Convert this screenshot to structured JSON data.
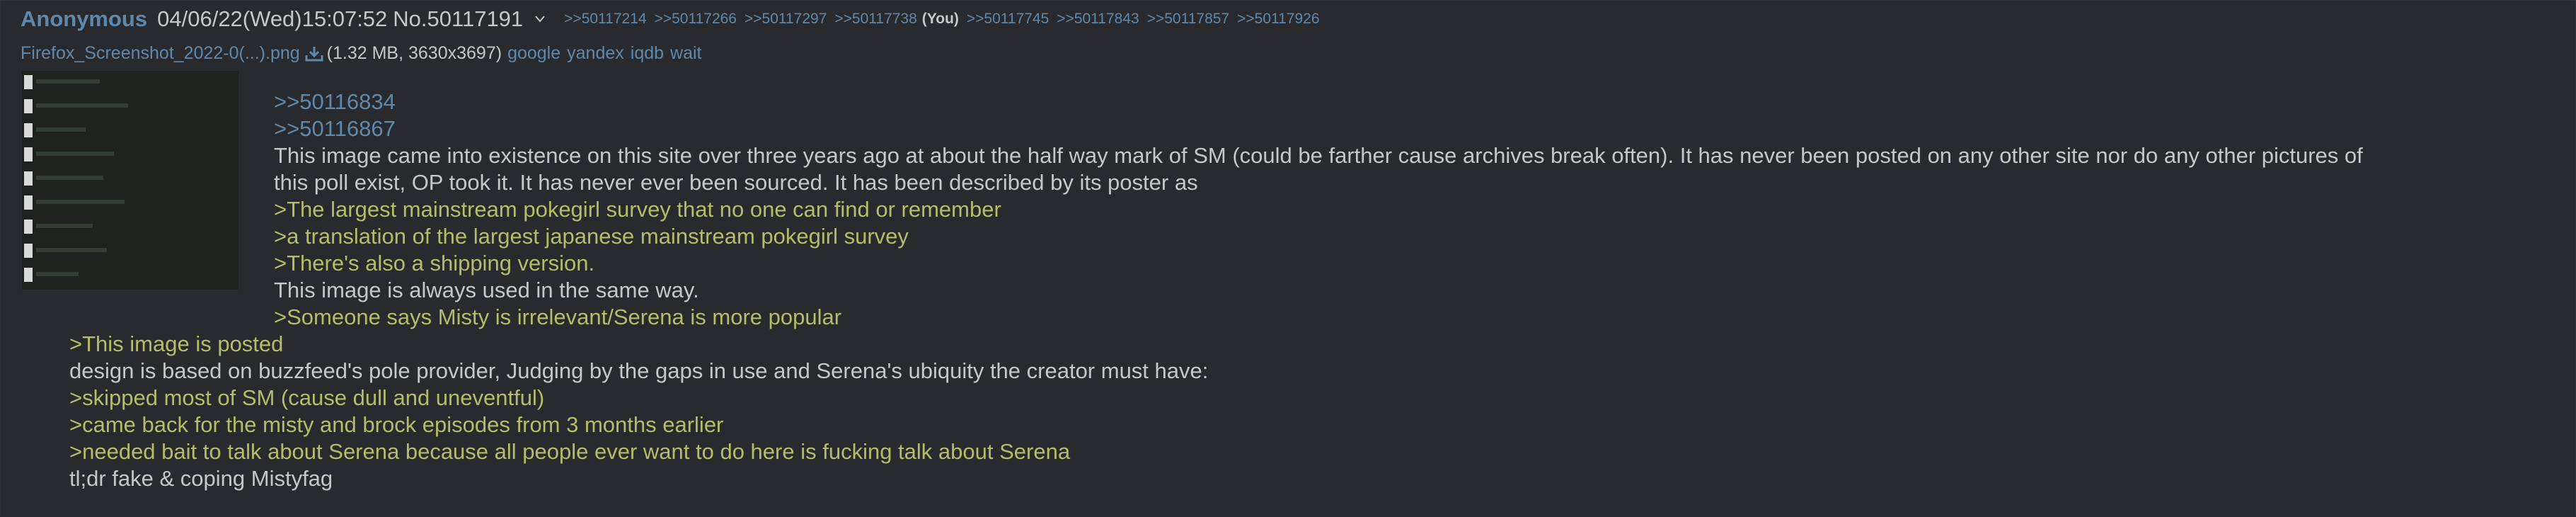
{
  "post": {
    "name": "Anonymous",
    "datetime": "04/06/22(Wed)15:07:52",
    "post_number": "No.50117191",
    "backlinks": [
      ">>50117214",
      ">>50117266",
      ">>50117297",
      ">>50117738",
      ">>50117745",
      ">>50117843",
      ">>50117857",
      ">>50117926"
    ],
    "you_marker": "(You)",
    "file": {
      "name": "Firefox_Screenshot_2022-0(...).png",
      "meta": "(1.32 MB, 3630x3697)",
      "search": [
        "google",
        "yandex",
        "iqdb",
        "wait"
      ]
    },
    "message": {
      "quotelinks": [
        ">>50116834",
        ">>50116867"
      ],
      "lines_beside_image": [
        {
          "type": "text",
          "text": "This image came into existence on this site over three years ago at about the half way mark of SM (could be farther cause archives break often). It has never been posted on any other site nor do any other pictures of"
        },
        {
          "type": "text",
          "text": "this poll exist, OP took it. It has never ever been sourced. It has been described by its poster as"
        },
        {
          "type": "quote",
          "text": ">The largest mainstream pokegirl survey that no one can find or remember"
        },
        {
          "type": "quote",
          "text": ">a translation of the largest japanese mainstream pokegirl survey"
        },
        {
          "type": "quote",
          "text": ">There's also a shipping version."
        },
        {
          "type": "text",
          "text": "This image is always used in the same way."
        },
        {
          "type": "quote",
          "text": ">Someone says Misty is irrelevant/Serena is more popular"
        }
      ],
      "lines_below_image": [
        {
          "type": "quote",
          "text": ">This image is posted"
        },
        {
          "type": "text",
          "text": "design is based on buzzfeed's pole provider, Judging by the gaps in use and Serena's ubiquity the creator must have:"
        },
        {
          "type": "quote",
          "text": ">skipped most of SM (cause dull and uneventful)"
        },
        {
          "type": "quote",
          "text": ">came back for the misty and brock episodes from 3 months earlier"
        },
        {
          "type": "quote",
          "text": ">needed bait to talk about Serena because all people ever want to do here is fucking talk about Serena"
        },
        {
          "type": "text",
          "text": "tl;dr fake & coping Mistyfag"
        }
      ]
    }
  },
  "colors": {
    "background": "#282a2e",
    "link": "#5f89ac",
    "greentext": "#b5bd68",
    "text": "#c5c8c6"
  },
  "icons": {
    "menu": "chevron-down-icon",
    "download": "download-icon"
  }
}
